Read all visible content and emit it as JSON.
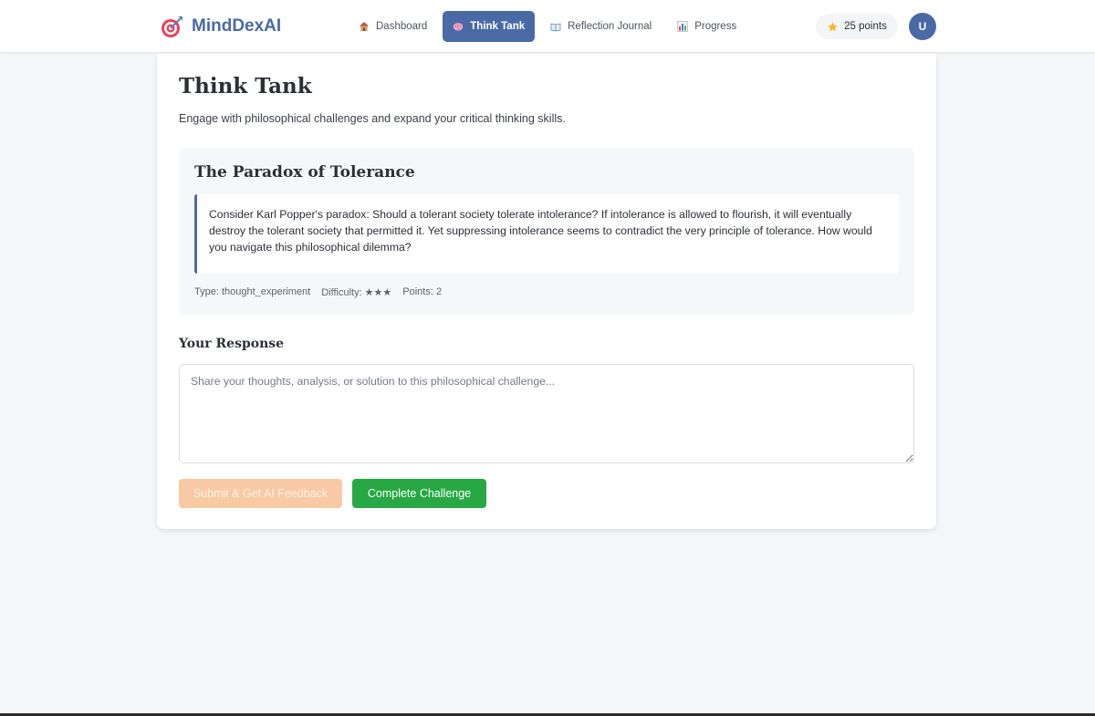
{
  "brand": {
    "name": "MindDexAI",
    "icon": "target-dart-icon"
  },
  "nav": {
    "items": [
      {
        "label": "Dashboard",
        "icon": "house-icon",
        "active": false
      },
      {
        "label": "Think Tank",
        "icon": "brain-icon",
        "active": true
      },
      {
        "label": "Reflection Journal",
        "icon": "book-icon",
        "active": false
      },
      {
        "label": "Progress",
        "icon": "bar-chart-icon",
        "active": false
      }
    ]
  },
  "user": {
    "points_label": "25 points",
    "avatar_initial": "U"
  },
  "page": {
    "title": "Think Tank",
    "subtitle": "Engage with philosophical challenges and expand your critical thinking skills."
  },
  "challenge": {
    "title": "The Paradox of Tolerance",
    "body": "Consider Karl Popper's paradox: Should a tolerant society tolerate intolerance? If intolerance is allowed to flourish, it will eventually destroy the tolerant society that permitted it. Yet suppressing intolerance seems to contradict the very principle of tolerance. How would you navigate this philosophical dilemma?",
    "type_label": "Type: thought_experiment",
    "difficulty_label": "Difficulty: ★★★",
    "points_label": "Points: 2"
  },
  "response": {
    "title": "Your Response",
    "placeholder": "Share your thoughts, analysis, or solution to this philosophical challenge...",
    "value": ""
  },
  "buttons": {
    "submit_label": "Submit & Get AI Feedback",
    "complete_label": "Complete Challenge"
  },
  "colors": {
    "primary": "#4a6aa6",
    "success": "#27a845",
    "submit_disabled": "#f8c9a2",
    "star": "#f4b824"
  }
}
